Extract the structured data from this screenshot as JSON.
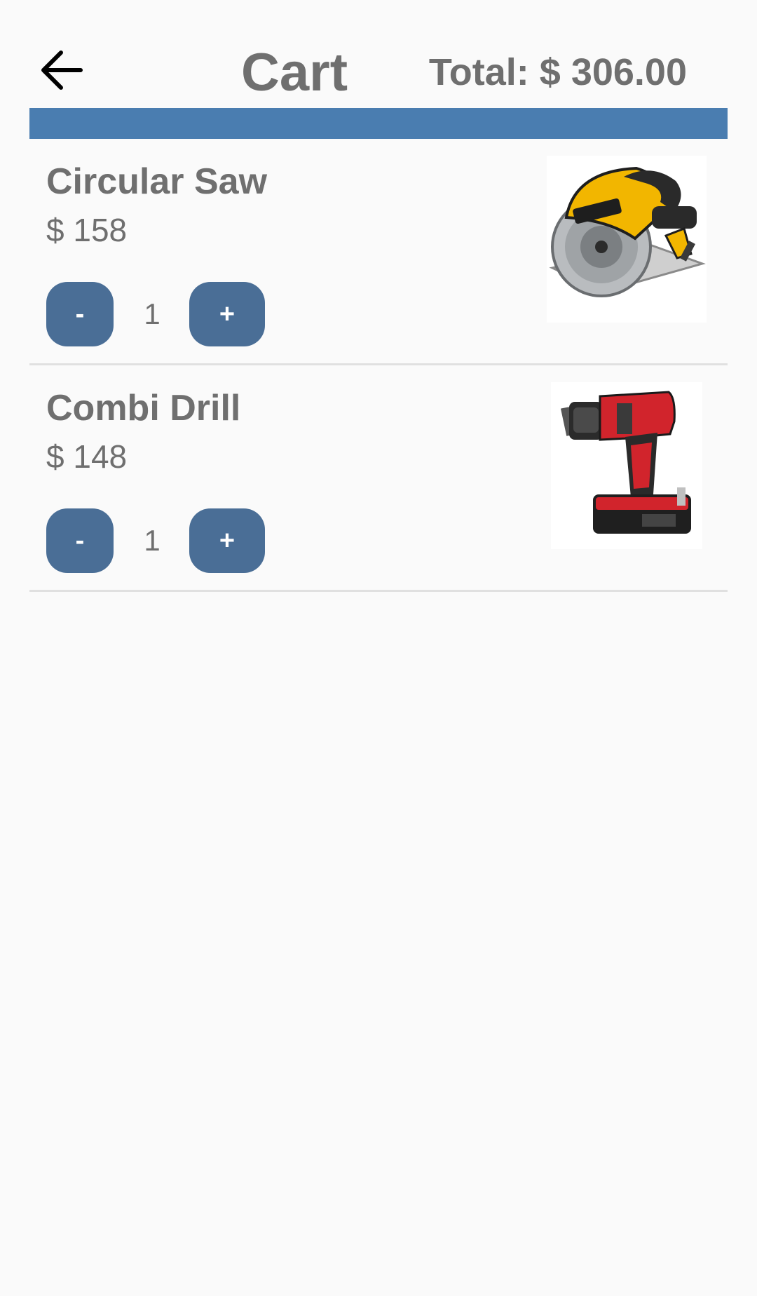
{
  "header": {
    "title": "Cart",
    "total": "Total: $ 306.00",
    "back_icon": "arrow-left-icon"
  },
  "colors": {
    "accent_bar": "#4a7db0",
    "button": "#4a6e96",
    "text": "#6f6f6f",
    "background": "#fafafa",
    "divider": "#e0e0e0"
  },
  "cart": {
    "items": [
      {
        "name": "Circular Saw",
        "price": "$ 158",
        "quantity": "1",
        "minus_label": "-",
        "plus_label": "+",
        "image_icon": "circular-saw-image"
      },
      {
        "name": "Combi Drill",
        "price": "$ 148",
        "quantity": "1",
        "minus_label": "-",
        "plus_label": "+",
        "image_icon": "combi-drill-image"
      }
    ]
  }
}
